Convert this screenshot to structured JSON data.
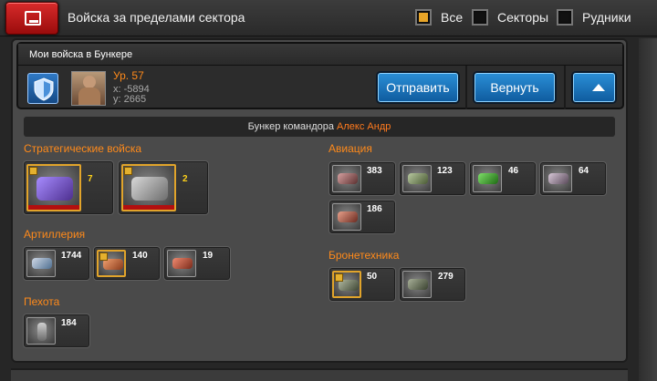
{
  "header": {
    "title": "Войска за пределами сектора",
    "filters": [
      {
        "label": "Все",
        "checked": true
      },
      {
        "label": "Секторы",
        "checked": false
      },
      {
        "label": "Рудники",
        "checked": false
      }
    ]
  },
  "bunker": {
    "title": "Мои войска в Бункере",
    "level": "Ур. 57",
    "x": "x: -5894",
    "y": "y: 2665",
    "send_label": "Отправить",
    "return_label": "Вернуть"
  },
  "commander": {
    "label": "Бункер командора",
    "name": "Алекс Андр"
  },
  "sections": {
    "strategic": {
      "title": "Стратегические войска",
      "units": [
        {
          "count": "7",
          "icon": "strategic-mech-icon"
        },
        {
          "count": "2",
          "icon": "strategic-walker-icon"
        }
      ]
    },
    "artillery": {
      "title": "Артиллерия",
      "units": [
        {
          "count": "1744",
          "icon": "artillery-launcher-icon"
        },
        {
          "count": "140",
          "icon": "artillery-rocket-icon"
        },
        {
          "count": "19",
          "icon": "artillery-heavy-icon"
        }
      ]
    },
    "infantry": {
      "title": "Пехота",
      "units": [
        {
          "count": "184",
          "icon": "infantry-soldier-icon"
        }
      ]
    },
    "aviation": {
      "title": "Авиация",
      "units": [
        {
          "count": "383",
          "icon": "aviation-gunship-icon"
        },
        {
          "count": "123",
          "icon": "aviation-helicopter-icon"
        },
        {
          "count": "46",
          "icon": "aviation-green-drone-icon"
        },
        {
          "count": "64",
          "icon": "aviation-fighter-icon"
        },
        {
          "count": "186",
          "icon": "aviation-bomber-icon"
        }
      ]
    },
    "armor": {
      "title": "Бронетехника",
      "units": [
        {
          "count": "50",
          "icon": "armor-tank-icon"
        },
        {
          "count": "279",
          "icon": "armor-heavy-tank-icon"
        }
      ]
    }
  },
  "colors": {
    "accent_orange": "#ff8a1a",
    "button_blue": "#1a74bd",
    "close_red": "#c21c1c",
    "rank_gold": "#e4b02e"
  }
}
